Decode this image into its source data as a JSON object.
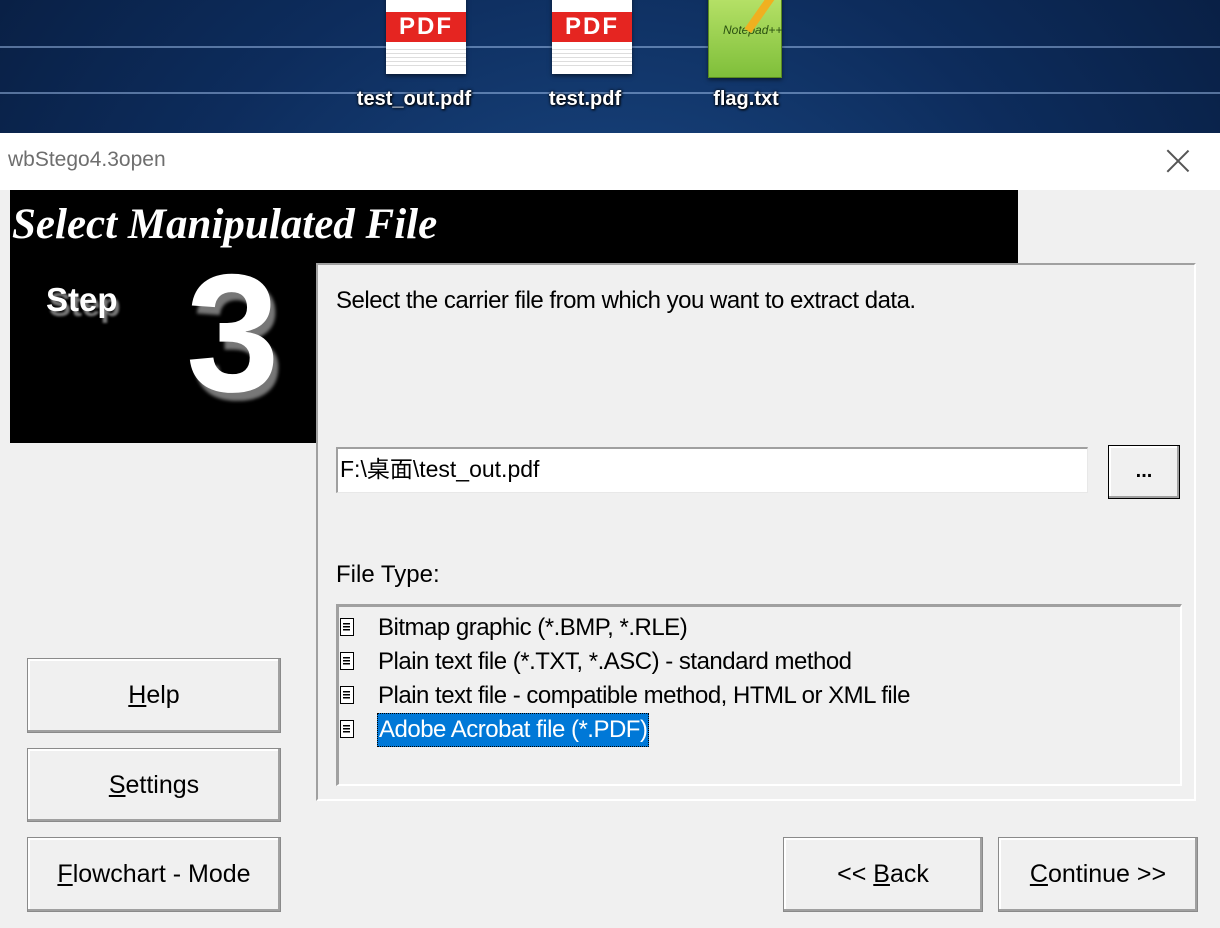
{
  "desktop": {
    "icons": [
      {
        "label": "test_out.pdf",
        "badge": "PDF",
        "icon": "pdf-file-icon"
      },
      {
        "label": "test.pdf",
        "badge": "PDF",
        "icon": "pdf-file-icon"
      },
      {
        "label": "flag.txt",
        "badge": "Notepad++",
        "icon": "notepad-plus-plus-icon"
      }
    ]
  },
  "window": {
    "title": "wbStego4.3open",
    "close_icon": "close-icon"
  },
  "banner": {
    "heading": "Select Manipulated File",
    "step_label": "Step",
    "step_number": "3"
  },
  "panel": {
    "instruction": "Select the carrier file from which you want to extract data.",
    "file_path": "F:\\桌面\\test_out.pdf",
    "browse_label": "...",
    "file_type_label": "File Type:",
    "file_types": [
      {
        "label": "Bitmap graphic (*.BMP, *.RLE)",
        "selected": false
      },
      {
        "label": "Plain text file (*.TXT, *.ASC) - standard method",
        "selected": false
      },
      {
        "label": "Plain text file - compatible method, HTML or XML file",
        "selected": false
      },
      {
        "label": "Adobe Acrobat file (*.PDF)",
        "selected": true
      }
    ]
  },
  "buttons": {
    "help": {
      "mnemonic": "H",
      "rest": "elp"
    },
    "settings": {
      "mnemonic": "S",
      "rest": "ettings"
    },
    "flowchart": {
      "mnemonic": "F",
      "rest": "lowchart - Mode"
    },
    "back": {
      "prefix": "<< ",
      "mnemonic": "B",
      "rest": "ack"
    },
    "continue": {
      "mnemonic": "C",
      "rest": "ontinue >>"
    }
  },
  "colors": {
    "selection": "#0078d7",
    "pdf_badge": "#e52521",
    "banner_bg": "#000000",
    "window_bg": "#f0f0f0"
  }
}
